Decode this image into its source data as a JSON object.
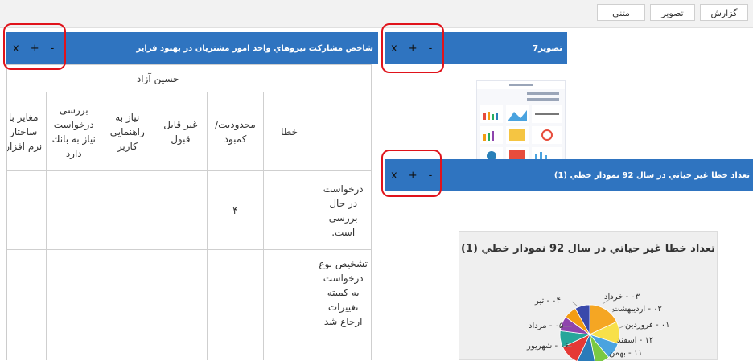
{
  "toolbar": {
    "report_label": "گزارش",
    "image_label": "تصویر",
    "text_label": "متنی"
  },
  "panel_main": {
    "title": "شاخص مشارکت نیروهاي واحد امور مشتریان در بهبود فرایر",
    "close": "x",
    "add": "+",
    "minimize": "-"
  },
  "panel_image": {
    "title": "تصویر7",
    "close": "x",
    "add": "+",
    "minimize": "-"
  },
  "panel_chart": {
    "title": "تعداد خطا غیر حیاتي در سال 92 نمودار خطي (1)",
    "close": "x",
    "add": "+",
    "minimize": "-"
  },
  "table": {
    "group_header": "حسین آزاد",
    "columns": [
      "خطا",
      "محدودیت/ کمبود",
      "غیر قابل قبول",
      "نیاز به راهنمایی کاربر",
      "بررسی درخواست نیاز به بانك دارد",
      "مغایر با ساختار نرم افزار"
    ],
    "rows": [
      {
        "label": "درخواست در حال بررسی است.",
        "cells": [
          "",
          "۴",
          "",
          "",
          "",
          ""
        ]
      },
      {
        "label": "تشخیص نوع درخواست به کمیته تغییرات ارجاع شد",
        "cells": [
          "",
          "",
          "",
          "",
          "",
          ""
        ]
      }
    ]
  },
  "chart_data": {
    "type": "pie",
    "title": "تعداد خطا غیر حیاتي در سال 92 نمودار خطي (1)",
    "legend_labels": [
      "۰۳ - خرداد",
      "۰۲ - اردیبهشت",
      "۰۱ - فروردین",
      "۱۲ - اسفند",
      "۱۱ - بهمن",
      "۰۴ - تیر",
      "۰۵ - مرداد",
      "۰۶ - شهریور"
    ],
    "slice_colors": [
      "#f5a623",
      "#f8e04a",
      "#4aa3df",
      "#7ac943",
      "#2b7bb9",
      "#e53935",
      "#26a69a",
      "#8e44ad",
      "#f39c12",
      "#3949ab"
    ],
    "slice_values": [
      18,
      12,
      9,
      8,
      10,
      11,
      9,
      8,
      7,
      8
    ]
  }
}
